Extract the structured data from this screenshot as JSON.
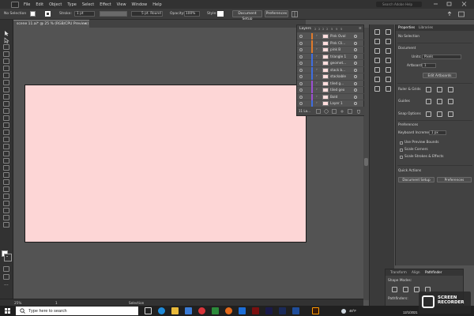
{
  "menu": {
    "items": [
      "File",
      "Edit",
      "Object",
      "Type",
      "Select",
      "Effect",
      "View",
      "Window",
      "Help"
    ],
    "search_placeholder": "Search Adobe Help"
  },
  "controlbar": {
    "selection": "No Selection",
    "stroke_label": "Stroke:",
    "stroke_value": "1 pt",
    "brush": "5 pt. Round",
    "opacity_label": "Opacity:",
    "opacity_value": "100%",
    "style_label": "Style:",
    "doc_setup": "Document Setup",
    "preferences": "Preferences"
  },
  "document": {
    "tab": "scene 11.ai* @ 25 % (RGB/CPU Preview)",
    "artboard_color": "#fdd6d6"
  },
  "layers": {
    "title": "Layers",
    "tab_numbers": [
      "2",
      "2",
      "2",
      "2",
      "5",
      "5",
      "5"
    ],
    "rows": [
      {
        "name": "Pink Oval",
        "color": "#e07a2a"
      },
      {
        "name": "Pink Cli...",
        "color": "#e07a2a"
      },
      {
        "name": "pink B",
        "color": "#e07a2a"
      },
      {
        "name": "triangle 1",
        "color": "#3f6de0"
      },
      {
        "name": "geomet...",
        "color": "#3f6de0"
      },
      {
        "name": "stack b...",
        "color": "#3f6de0"
      },
      {
        "name": "stackable",
        "color": "#3f6de0"
      },
      {
        "name": "tiled g...",
        "color": "#9b4fd3"
      },
      {
        "name": "tiled geo",
        "color": "#9b4fd3"
      },
      {
        "name": "Bold",
        "color": "#9b4fd3"
      },
      {
        "name": "Layer 1",
        "color": "#3f6de0"
      }
    ],
    "footer_count": "11 La..."
  },
  "properties": {
    "tab_properties": "Properties",
    "tab_libraries": "Libraries",
    "selection": "No Selection",
    "document_label": "Document",
    "units_label": "Units:",
    "units_value": "Pixels",
    "artboard_label": "Artboard:",
    "artboard_value": "1",
    "edit_artboards": "Edit Artboards",
    "rulers_label": "Ruler & Grids",
    "guides_label": "Guides",
    "snap_label": "Snap Options",
    "preferences_label": "Preferences",
    "keyboard_label": "Keyboard Increment:",
    "keyboard_value": "1 px",
    "check1": "Use Preview Bounds",
    "check2": "Scale Corners",
    "check3": "Scale Strokes & Effects",
    "quick_actions": "Quick Actions",
    "doc_setup_btn": "Document Setup",
    "prefs_btn": "Preferences"
  },
  "pathfinder": {
    "tabs": [
      "Transform",
      "Align",
      "Pathfinder"
    ],
    "shape_modes": "Shape Modes:",
    "pathfinders": "Pathfinders:"
  },
  "status": {
    "zoom": "25%",
    "page": "1",
    "tool": "Selection"
  },
  "taskbar": {
    "search_text": "Type here to search",
    "temp": "46°F",
    "date": "12/1/2021"
  },
  "recorder": {
    "line1": "SCREEN",
    "line2": "RECORDER"
  }
}
